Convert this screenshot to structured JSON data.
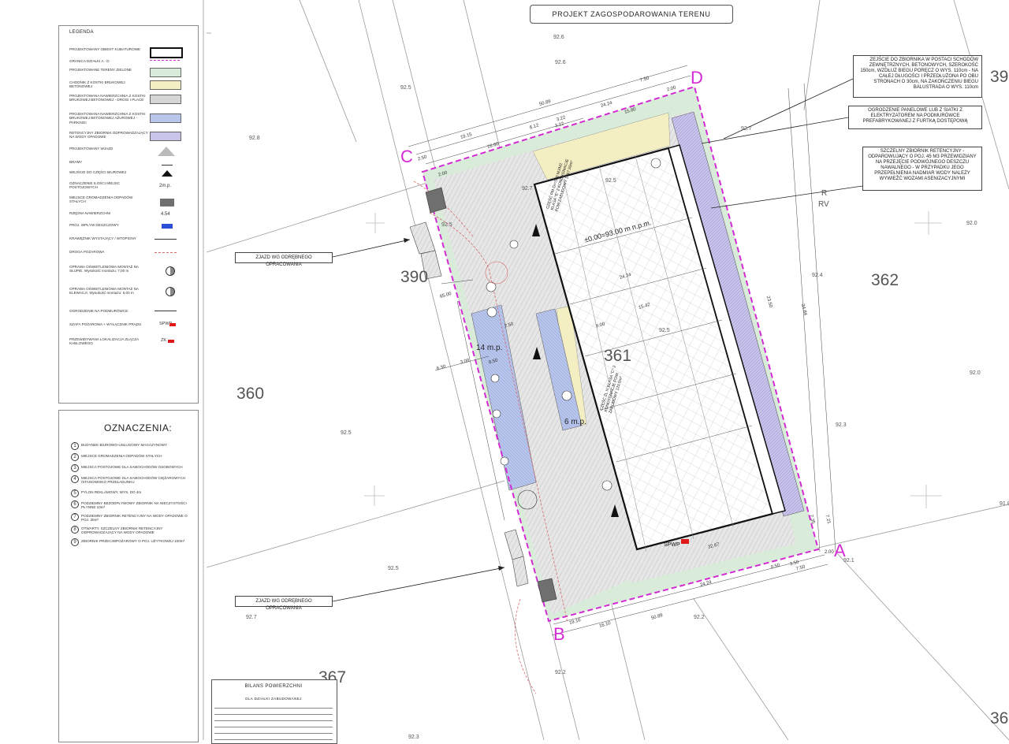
{
  "title": "PROJEKT ZAGOSPODAROWANIA TERENU",
  "legend": {
    "title": "LEGENDA",
    "items": [
      "PROJEKTOWANY OBIEKT KUBATUROWE",
      "GRANICA DZIAŁKI A - D",
      "PROJEKTOWANE TERENY ZIELONE",
      "CHODNIK Z KOSTKI BRUKOWEJ BETONOWEJ",
      "PROJEKTOWANA NAWIERZCHNIA Z KOSTKI BRUKOWEJ BETONOWEJ - DROGI I PLACE",
      "PROJEKTOWANA NAWIERZCHNIA Z KOSTKI BRUKOWEJ BETONOWEJ AŻUROWEJ - PARKINGI",
      "RETENCYJNY ZBIORNIK ODPROWADZAJĄCY NA WODY OPADOWE",
      "PROJEKTOWANY WJAZD",
      "BRAMY",
      "WEJŚCIE DO CZĘŚCI BIUROWEJ",
      "OZNACZENIE ILOŚCI MIEJSC POSTOJOWYCH",
      "MIEJSCE GROMADZENIA ODPADÓW STAŁYCH",
      "RZĘDNA NAWIERZCHNI",
      "PROJ. WPŁYW DESZCZOWY",
      "KRAWĘŻNIK WYSTAJĄCY / WTOPIONY",
      "DROGA POŻAROWA",
      "OPRAWA OŚWIETLENIOWA MONTAŻ NA SŁUPIE. Wysokość montażu: 7,00 m",
      "OPRAWA OŚWIETLENIOWA MONTAŻ NA ELEWACJI. Wysokość montażu: 6,00 m",
      "OGRODZENIE NA PODMURÓWCE",
      "SZAFA POŻAROWA + WYŁĄCZNIK PRĄDU",
      "PRZEWIDYWANA LOKALIZACJA ZŁĄCZA KABLOWEGO"
    ],
    "symbols": {
      "places": "2m.p.",
      "elevation": "4.54",
      "spwp": "SPWP",
      "zk": "ZK"
    }
  },
  "marks": {
    "title": "OZNACZENIA:",
    "items": [
      {
        "num": "1",
        "text": "BUDYNEK BIUROWO-USŁUGOWY MAGAZYNOWY"
      },
      {
        "num": "2",
        "text": "MIEJSCE GROMADZENIA ODPADÓW STAŁYCH"
      },
      {
        "num": "3",
        "text": "MIEJSCA POSTOJOWE DLA SAMOCHODÓW OSOBOWYCH"
      },
      {
        "num": "4",
        "text": "MIEJSCA POSTOJOWE DLA SAMOCHODÓW CIĘŻAROWYCH /STANOWISKO PRZEŁADUNKU"
      },
      {
        "num": "5",
        "text": "PYLON REKLAMOWY, WYS. DO 4m"
      },
      {
        "num": "6",
        "text": "PODZIEMNY BEZODPŁYWOWY ZBIORNIK NA NIECZYSTOŚCI PŁYNNE 10m³"
      },
      {
        "num": "7",
        "text": "PODZIEMNY ZBIORNIK RETENCYJNY NA WODY OPADOWE O POJ. 30m³"
      },
      {
        "num": "8",
        "text": "OTWARTY, SZCZELNY ZBIORNIK RETENCYJNY ODPROWADZAJĄCY NA WODY OPADOWE"
      },
      {
        "num": "9",
        "text": "ZBIORNIK PRZECIWPOŻAROWY O POJ. UŻYTKOWEJ 100m³"
      }
    ]
  },
  "callouts": {
    "stairs": "ZEJŚCIE DO ZBIORNIKA W POSTACI SCHODÓW ZEWNĘTRZNYCH, BETONOWYCH, SZEROKOŚĆ 150cm, WZDŁUŻ BIEGU PORĘCZ O WYS. 110cm - NA CAŁEJ DŁUGOŚCI I PRZEDŁUŻONA PO OBU STRONACH O 30cm, NA ZAKOŃCZENIU BIEGU BALUSTRADA O WYS. 110cm",
    "fence": "OGRODZENIE PANELOWE LUB Z SIATKI Z ELEKTRYZATOREM NA PODMURÓWCE PREFABRYKOWANEJ Z FURTKĄ DOSTĘPOWĄ",
    "tank": "SZCZELNY ZBIORNIK RETENCYJNY - ODPAROWUJĄCY O POJ. 45 M3 PRZEWIDZIANY NA PRZEJĘCIE PODWÓJNEGO DESZCZU NAWALNEGO - W PRZYPADKU JEGO PRZEPEŁNIENIA NADMIAR WODY NALEŻY WYWIEŹĆ WOZAMI ASENIZACYJNYMI",
    "entry1": "ZJAZD WG ODRĘBNEGO OPRACOWANIA",
    "entry2": "ZJAZD WG ODRĘBNEGO OPRACOWANIA"
  },
  "plots": {
    "p390": "390",
    "p362": "362",
    "p360": "360",
    "p361": "361",
    "p367": "367",
    "p39": "39",
    "p36": "36"
  },
  "corners": {
    "a": "A",
    "b": "B",
    "c": "C",
    "d": "D"
  },
  "rv": {
    "r": "R",
    "rv": "RV"
  },
  "building": {
    "level": "±0.00=93.00 m n.p.m.",
    "spec": "CZĘŚĆ PM Gr<500 MJ/M2 KLASA \"E\" 2 KONDYGNACJE POW.ZABUDOWY 1467.50m²",
    "office": "CZĘŚĆ ZL III KLASA \"C\" 2 KONDYGNACJE POW. ZABUDOWY 120.5m²"
  },
  "parking": {
    "p14": "14 m.p.",
    "p6": "6 m.p."
  },
  "spwp_label": "SPWP",
  "elevations": [
    "92.6",
    "92.5",
    "92.8",
    "92.7",
    "92.5",
    "92.4",
    "92.5",
    "92.5",
    "92.3",
    "92.2",
    "92.1",
    "92.0",
    "92.0",
    "92.7",
    "92.6",
    "92.5",
    "92.7",
    "92.5",
    "91.8",
    "92.2",
    "92.3"
  ],
  "dims": [
    "50.89",
    "24.24",
    "15.80",
    "3.22",
    "7.50",
    "2.00",
    "19.15",
    "16.60",
    "6.12",
    "3.22",
    "2.50",
    "2.00",
    "24.24",
    "15.42",
    "9.00",
    "34.84",
    "23.50",
    "7.21",
    "7.35",
    "2.00",
    "7.50",
    "3.50",
    "0.50",
    "24.24",
    "50.89",
    "19.16",
    "16.10",
    "6.30",
    "3.00",
    "8.50",
    "2.50",
    "32.67",
    "65.00"
  ],
  "bilans": {
    "title": "BILANS POWIERZCHNI",
    "sub": "DLA DZIAŁKI ZABUDOWANEJ"
  }
}
